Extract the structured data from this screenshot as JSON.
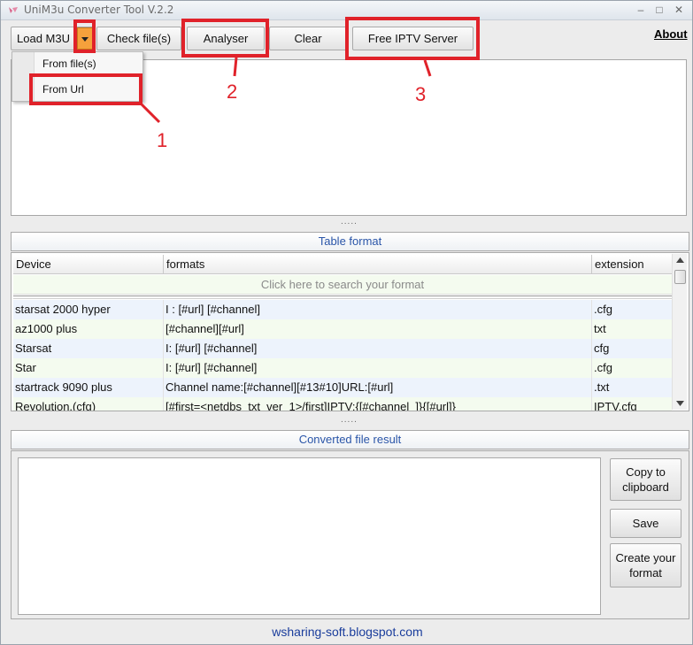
{
  "window": {
    "title": "UniM3u Converter Tool V.2.2",
    "minimize_glyph": "–",
    "maximize_glyph": "□",
    "close_glyph": "✕"
  },
  "toolbar": {
    "load_m3u": "Load M3U",
    "check_files": "Check file(s)",
    "analyser": "Analyser",
    "clear": "Clear",
    "free_iptv": "Free IPTV Server",
    "about": "About"
  },
  "load_menu": {
    "items": [
      "From file(s)",
      "From Url"
    ]
  },
  "table_section": {
    "header": "Table format",
    "columns": [
      "Device",
      "formats",
      "extension"
    ],
    "search_placeholder": "Click here to search your format",
    "rows": [
      {
        "device": "starsat 2000 hyper",
        "format": "I : [#url] [#channel]",
        "extension": ".cfg"
      },
      {
        "device": "az1000 plus",
        "format": "[#channel][#url]",
        "extension": "txt"
      },
      {
        "device": "Starsat",
        "format": "I: [#url] [#channel]",
        "extension": "cfg"
      },
      {
        "device": "Star",
        "format": "I: [#url] [#channel]",
        "extension": ".cfg"
      },
      {
        "device": "startrack 9090 plus",
        "format": "Channel name:[#channel][#13#10]URL:[#url]",
        "extension": ".txt"
      },
      {
        "device": "Revolution.(cfg)",
        "format": "[#first=<netdbs_txt_ver_1>/first]IPTV:{[#channel_]}{[#url]}",
        "extension": "IPTV.cfg"
      }
    ]
  },
  "result_section": {
    "header": "Converted file result",
    "copy_button": "Copy to clipboard",
    "save_button": "Save",
    "create_button": "Create your format"
  },
  "grip_glyph": ".....",
  "footer": "wsharing-soft.blogspot.com",
  "annotations": [
    "1",
    "2",
    "3"
  ],
  "colors": {
    "annotation_red": "#e0222a",
    "dropdown_orange": "#f6a13c",
    "header_blue": "#2a55a8",
    "footer_blue": "#1a3d9c"
  }
}
